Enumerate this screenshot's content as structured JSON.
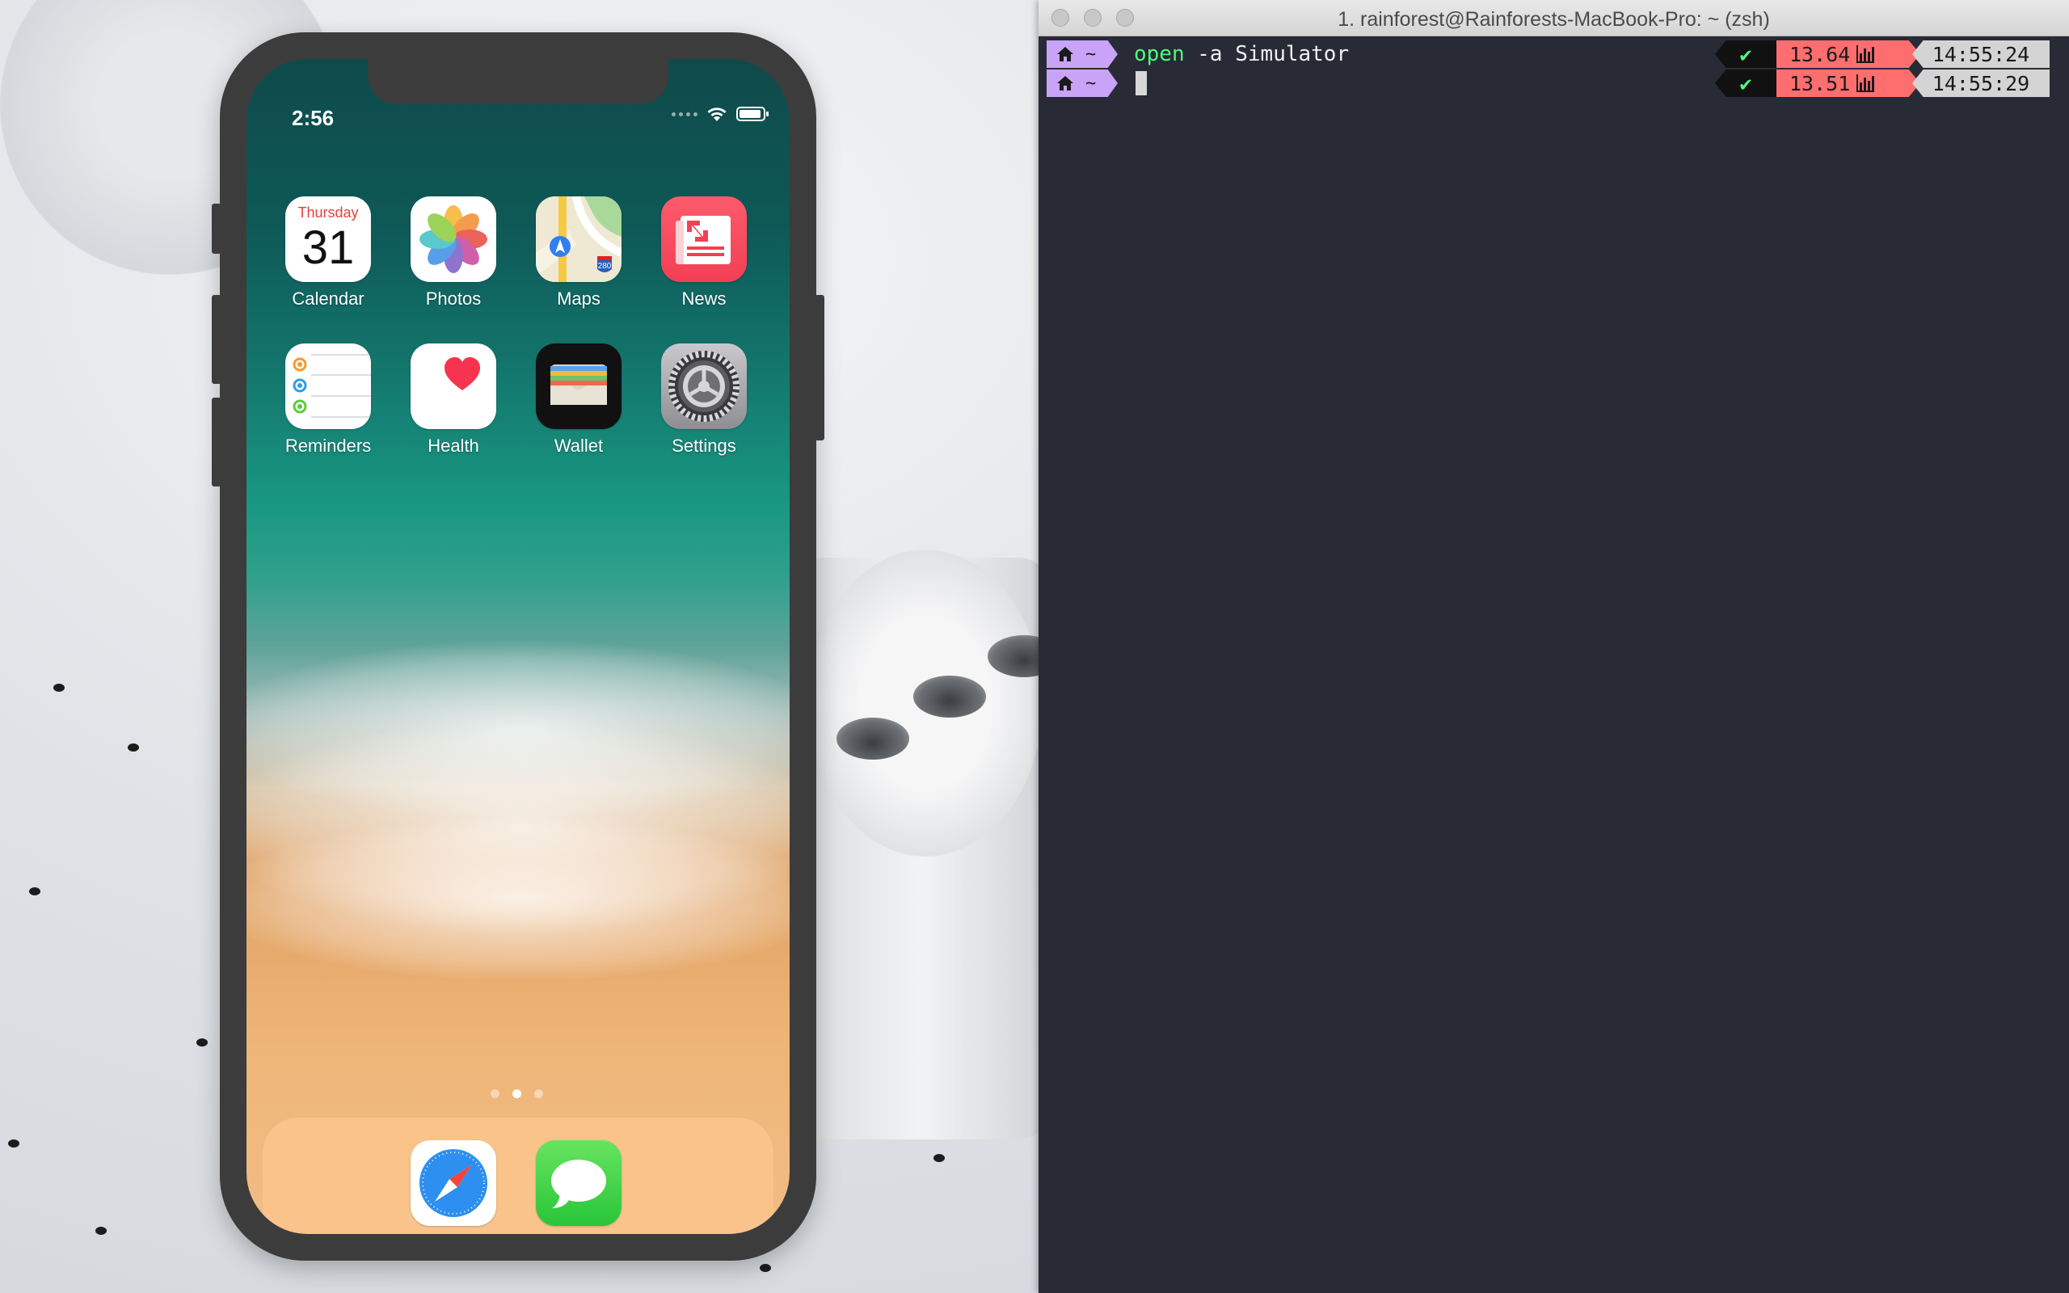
{
  "phone": {
    "status": {
      "time": "2:56"
    },
    "apps": [
      {
        "label": "Calendar",
        "icon": "calendar-icon",
        "day": "Thursday",
        "date": "31"
      },
      {
        "label": "Photos",
        "icon": "photos-icon"
      },
      {
        "label": "Maps",
        "icon": "maps-icon",
        "badge": "280"
      },
      {
        "label": "News",
        "icon": "news-icon"
      },
      {
        "label": "Reminders",
        "icon": "reminders-icon"
      },
      {
        "label": "Health",
        "icon": "health-icon"
      },
      {
        "label": "Wallet",
        "icon": "wallet-icon"
      },
      {
        "label": "Settings",
        "icon": "settings-icon"
      }
    ],
    "page_dots": {
      "count": 3,
      "active": 2
    },
    "dock": [
      {
        "icon": "safari-icon"
      },
      {
        "icon": "messages-icon"
      }
    ]
  },
  "terminal": {
    "title": "1. rainforest@Rainforests-MacBook-Pro: ~ (zsh)",
    "lines": [
      {
        "dir": "~",
        "command_keyword": "open",
        "command_rest": " -a Simulator",
        "load": "13.64",
        "time": "14:55:24"
      },
      {
        "dir": "~",
        "command_keyword": "",
        "command_rest": "",
        "load": "13.51",
        "time": "14:55:29"
      }
    ],
    "colors": {
      "home_segment": "#c9a3f7",
      "load_segment": "#ff6e6e",
      "time_segment": "#d4d4d4",
      "keyword": "#50fa7b",
      "background": "#282a36"
    }
  }
}
